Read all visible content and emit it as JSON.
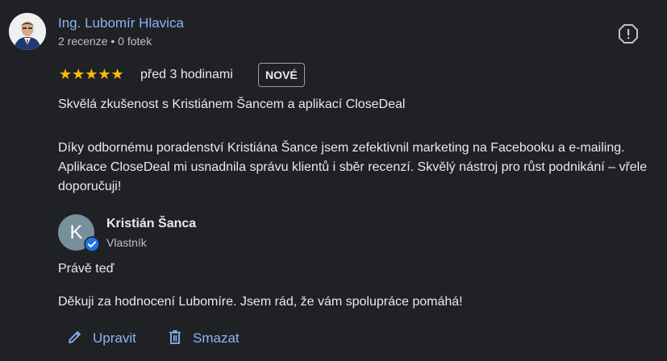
{
  "reviewer": {
    "name": "Ing. Lubomír Hlavica",
    "meta": "2 recenze • 0 fotek"
  },
  "rating": {
    "stars": 5,
    "stars_text": "★★★★★",
    "time": "před 3 hodinami",
    "badge": "NOVÉ"
  },
  "review": {
    "title": "Skvělá zkušenost s Kristiánem Šancem a aplikací CloseDeal",
    "body": "Díky odbornému poradenství Kristiána Šance jsem zefektivnil marketing na Facebooku a e-mailing. Aplikace CloseDeal mi usnadnila správu klientů i sběr recenzí. Skvělý nástroj pro růst podnikání – vřele doporučuji!"
  },
  "owner_reply": {
    "avatar_letter": "K",
    "name": "Kristián Šanca",
    "role": "Vlastník",
    "time": "Právě teď",
    "text": "Děkuji za hodnocení Lubomíre. Jsem rád, že vám spolupráce pomáhá!"
  },
  "actions": {
    "edit_label": "Upravit",
    "delete_label": "Smazat"
  },
  "icons": {
    "report": "report-flag-icon",
    "verified": "verified-check-icon",
    "edit": "pencil-icon",
    "delete": "trash-icon"
  },
  "colors": {
    "background": "#202124",
    "link": "#8ab4f8",
    "star": "#fbbc04",
    "verified": "#1a73e8"
  }
}
